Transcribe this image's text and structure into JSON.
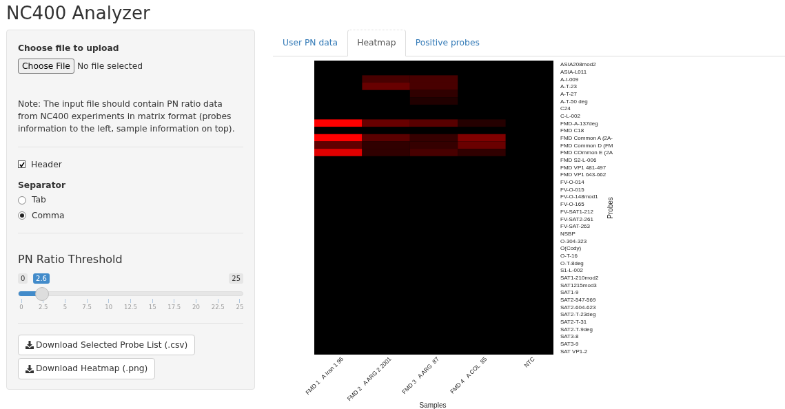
{
  "title": "NC400 Analyzer",
  "sidebar": {
    "file_label": "Choose file to upload",
    "file_button": "Choose File",
    "file_status": "No file selected",
    "note": "Note: The input file should contain PN ratio data from NC400 experiments in matrix format (probes information to the left, sample information on top).",
    "header_checkbox": {
      "label": "Header",
      "checked": true
    },
    "separator_label": "Separator",
    "separator_options": [
      {
        "label": "Tab",
        "selected": false
      },
      {
        "label": "Comma",
        "selected": true
      }
    ],
    "slider": {
      "label": "PN Ratio Threshold",
      "min": "0",
      "max": "25",
      "value": "2.6",
      "level": 0.104,
      "ticks": [
        "0",
        "2.5",
        "5",
        "7.5",
        "10",
        "12.5",
        "15",
        "17.5",
        "20",
        "22.5",
        "25"
      ]
    },
    "buttons": [
      "Download Selected Probe List (.csv)",
      "Download Heatmap (.png)"
    ]
  },
  "tabs": [
    {
      "label": "User PN data",
      "selected": false
    },
    {
      "label": "Heatmap",
      "selected": true
    },
    {
      "label": "Positive probes",
      "selected": false
    }
  ],
  "heatmap": {
    "ylabel": "Probes",
    "xlabel": "Samples",
    "rows": [
      "ASIA208mod2",
      "ASIA-L011",
      "A-I-009",
      "A-T-23",
      "A-T-27",
      "A-T-50 deg",
      "C24",
      "C-L-002",
      "FMD-A-137deg",
      "FMD C18",
      "FMD Common A (2A-",
      "FMD Common D (FM",
      "FMD COmmon E (2A",
      "FMD S2-L-006",
      "FMD VP1 481-497",
      "FMD VP1 643-662",
      "FV-O-014",
      "FV-O-015",
      "FV-O-148mod1",
      "FV-O-165",
      "FV-SAT1-212",
      "FV-SAT2-261",
      "FV-SAT-263",
      "NSBP",
      "O-304-323",
      "O(Cody)",
      "O-T-16",
      "O-T-8deg",
      "S1-L-002",
      "SAT1-210mod2",
      "SAT1215mod3",
      "SAT1-9",
      "SAT2-547-569",
      "SAT2-604-623",
      "SAT2-T-23deg",
      "SAT2-T-31",
      "SAT2-T-9deg",
      "SAT3-8",
      "SAT3-9",
      "SAT VP1-2"
    ],
    "columns": [
      "FMD 1   A Iran 1 96",
      "FMD 2   A ARG 2 2001",
      "FMD 3   A ARG  87",
      "FMD 4   A COL  85",
      "NTC"
    ]
  }
}
